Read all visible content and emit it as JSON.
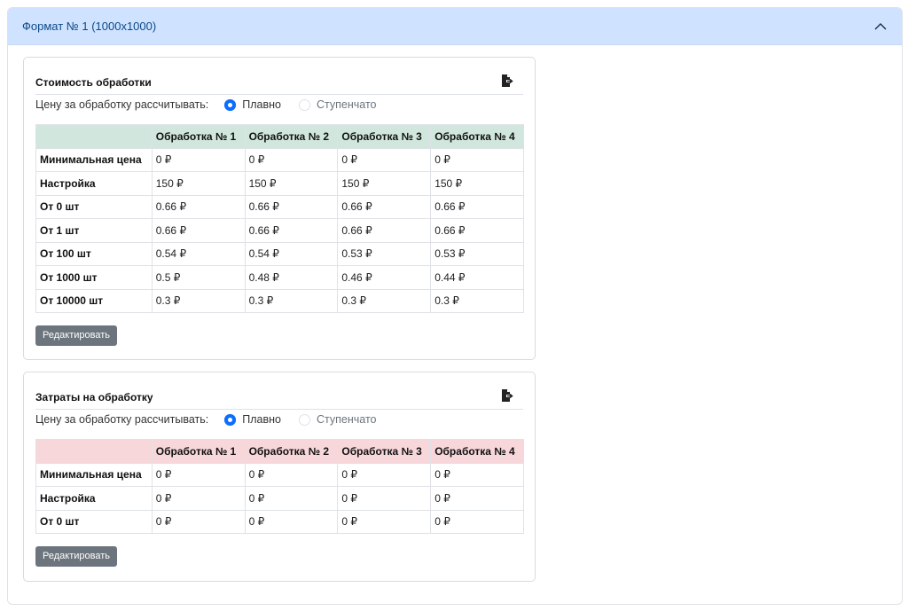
{
  "accordion": {
    "title": "Формат № 1 (1000x1000)"
  },
  "cost_card": {
    "title": "Стоимость обработки",
    "calc_label": "Цену за обработку рассчитывать:",
    "option_smooth": "Плавно",
    "option_step": "Ступенчато",
    "selected": "Плавно",
    "header_color": "#d1e7dd",
    "columns": [
      "",
      "Обработка № 1",
      "Обработка № 2",
      "Обработка № 3",
      "Обработка № 4"
    ],
    "rows": [
      {
        "label": "Минимальная цена",
        "values": [
          "0 ₽",
          "0 ₽",
          "0 ₽",
          "0 ₽"
        ]
      },
      {
        "label": "Настройка",
        "values": [
          "150 ₽",
          "150 ₽",
          "150 ₽",
          "150 ₽"
        ]
      },
      {
        "label": "От 0 шт",
        "values": [
          "0.66 ₽",
          "0.66 ₽",
          "0.66 ₽",
          "0.66 ₽"
        ]
      },
      {
        "label": "От 1 шт",
        "values": [
          "0.66 ₽",
          "0.66 ₽",
          "0.66 ₽",
          "0.66 ₽"
        ]
      },
      {
        "label": "От 100 шт",
        "values": [
          "0.54 ₽",
          "0.54 ₽",
          "0.53 ₽",
          "0.53 ₽"
        ]
      },
      {
        "label": "От 1000 шт",
        "values": [
          "0.5 ₽",
          "0.48 ₽",
          "0.46 ₽",
          "0.44 ₽"
        ]
      },
      {
        "label": "От 10000 шт",
        "values": [
          "0.3 ₽",
          "0.3 ₽",
          "0.3 ₽",
          "0.3 ₽"
        ]
      }
    ],
    "edit_label": "Редактировать"
  },
  "expense_card": {
    "title": "Затраты на обработку",
    "calc_label": "Цену за обработку рассчитывать:",
    "option_smooth": "Плавно",
    "option_step": "Ступенчато",
    "selected": "Плавно",
    "header_color": "#f8d7da",
    "columns": [
      "",
      "Обработка № 1",
      "Обработка № 2",
      "Обработка № 3",
      "Обработка № 4"
    ],
    "rows": [
      {
        "label": "Минимальная цена",
        "values": [
          "0 ₽",
          "0 ₽",
          "0 ₽",
          "0 ₽"
        ]
      },
      {
        "label": "Настройка",
        "values": [
          "0 ₽",
          "0 ₽",
          "0 ₽",
          "0 ₽"
        ]
      },
      {
        "label": "От 0 шт",
        "values": [
          "0 ₽",
          "0 ₽",
          "0 ₽",
          "0 ₽"
        ]
      }
    ],
    "edit_label": "Редактировать"
  },
  "icons": {
    "accordion_toggle": "chevron-up-icon",
    "export": "file-export-icon"
  }
}
